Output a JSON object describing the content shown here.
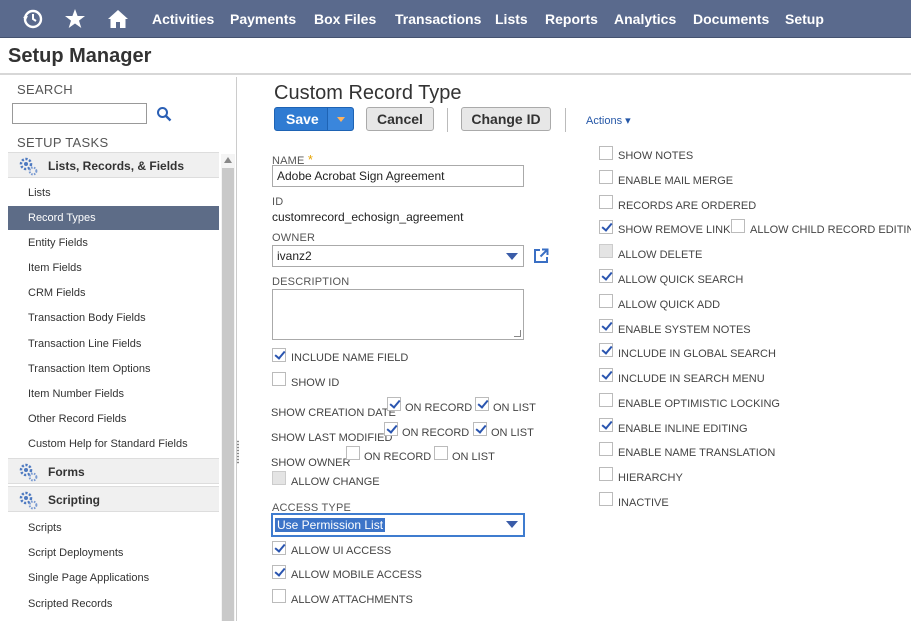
{
  "nav": {
    "items": [
      "Activities",
      "Payments",
      "Box Files",
      "Transactions",
      "Lists",
      "Reports",
      "Analytics",
      "Documents",
      "Setup"
    ]
  },
  "page_title": "Setup Manager",
  "sidebar": {
    "search_label": "SEARCH",
    "search_value": "",
    "tasks_label": "SETUP TASKS",
    "group_lists": "Lists, Records, & Fields",
    "items_lists": [
      "Lists",
      "Record Types",
      "Entity Fields",
      "Item Fields",
      "CRM Fields",
      "Transaction Body Fields",
      "Transaction Line Fields",
      "Transaction Item Options",
      "Item Number Fields",
      "Other Record Fields",
      "Custom Help for Standard Fields"
    ],
    "active_item": "Record Types",
    "group_forms": "Forms",
    "group_scripting": "Scripting",
    "items_scripting": [
      "Scripts",
      "Script Deployments",
      "Single Page Applications",
      "Scripted Records"
    ]
  },
  "form": {
    "title": "Custom Record Type",
    "buttons": {
      "save": "Save",
      "cancel": "Cancel",
      "change_id": "Change ID",
      "actions": "Actions ▾"
    },
    "name_label": "NAME",
    "name_value": "Adobe Acrobat Sign Agreement",
    "id_label": "ID",
    "id_value": "customrecord_echosign_agreement",
    "owner_label": "OWNER",
    "owner_value": "ivanz2",
    "description_label": "DESCRIPTION",
    "include_name_field": "INCLUDE NAME FIELD",
    "show_id": "SHOW ID",
    "show_creation_date": "SHOW CREATION DATE",
    "show_last_modified": "SHOW LAST MODIFIED",
    "show_owner": "SHOW OWNER",
    "on_record": "ON RECORD",
    "on_list": "ON LIST",
    "allow_change": "ALLOW CHANGE",
    "access_type_label": "ACCESS TYPE",
    "access_type_value": "Use Permission List",
    "allow_ui_access": "ALLOW UI ACCESS",
    "allow_mobile_access": "ALLOW MOBILE ACCESS",
    "allow_attachments": "ALLOW ATTACHMENTS"
  },
  "right_options": {
    "show_notes": "SHOW NOTES",
    "enable_mail_merge": "ENABLE MAIL MERGE",
    "records_are_ordered": "RECORDS ARE ORDERED",
    "show_remove_link": "SHOW REMOVE LINK",
    "allow_child_record_editing": "ALLOW CHILD RECORD EDITING",
    "allow_delete": "ALLOW DELETE",
    "allow_quick_search": "ALLOW QUICK SEARCH",
    "allow_quick_add": "ALLOW QUICK ADD",
    "enable_system_notes": "ENABLE SYSTEM NOTES",
    "include_in_global_search": "INCLUDE IN GLOBAL SEARCH",
    "include_in_search_menu": "INCLUDE IN SEARCH MENU",
    "enable_optimistic_locking": "ENABLE OPTIMISTIC LOCKING",
    "enable_inline_editing": "ENABLE INLINE EDITING",
    "enable_name_translation": "ENABLE NAME TRANSLATION",
    "hierarchy": "HIERARCHY",
    "inactive": "INACTIVE"
  },
  "colors": {
    "nav_bg": "#5a6a8d",
    "save_button": "#2f7bd2",
    "active_item": "#5d6c87",
    "checkmark": "#2a55b0"
  }
}
